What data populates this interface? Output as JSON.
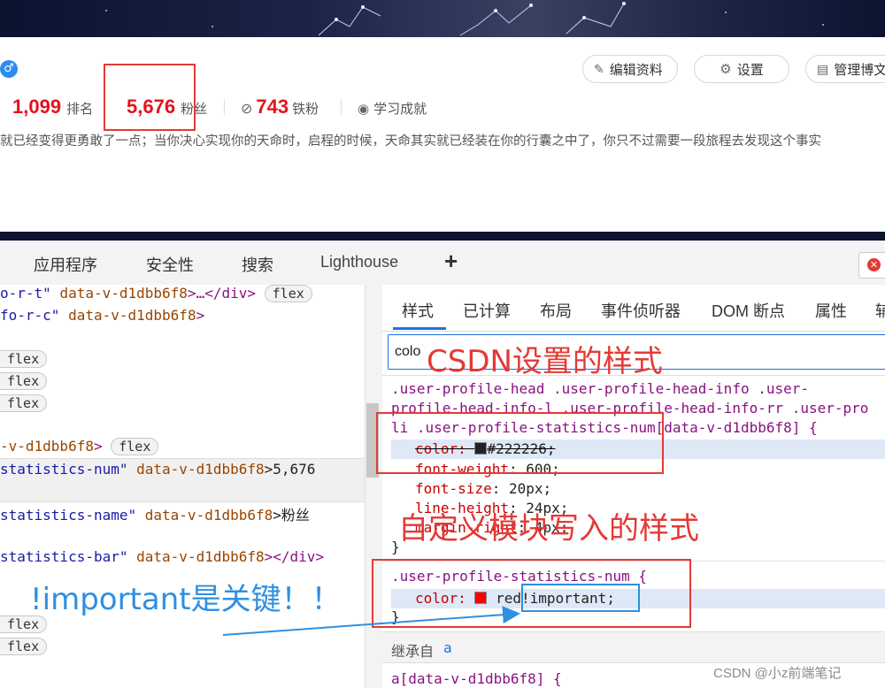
{
  "profile": {
    "buttons": {
      "edit": "编辑资料",
      "settings": "设置",
      "manage": "管理博文"
    },
    "stats": [
      {
        "num": "1,099",
        "name": "排名"
      },
      {
        "num": "5,676",
        "name": "粉丝"
      },
      {
        "num": "743",
        "name": "铁粉"
      }
    ],
    "achievement": "学习成就",
    "motto": "就已经变得更勇敢了一点；当你决心实现你的天命时，启程的时候，天命其实就已经装在你的行囊之中了，你只不过需要一段旅程去发现这个事实"
  },
  "devtools": {
    "tabs": [
      "应用程序",
      "安全性",
      "搜索",
      "Lighthouse"
    ],
    "add": "+",
    "subtabs": [
      "样式",
      "已计算",
      "布局",
      "事件侦听器",
      "DOM 断点",
      "属性",
      "辅"
    ],
    "filter_value": "colo",
    "elements": {
      "l1_attr": "o-r-t\"",
      "l1_dv": "data-v-d1dbb6f8",
      "l1_tail": ">…</div>",
      "flex": "flex",
      "l2_attr": "fo-r-c\"",
      "l2_dv": "data-v-d1dbb6f8",
      "l2_tail": ">",
      "l6_dv": "-v-d1dbb6f8",
      "l6_tail": ">",
      "l7_cls": "statistics-num\"",
      "l7_dv": "data-v-d1dbb6f8",
      "l7_tail": ">5,676",
      "l8_cls": "statistics-name\"",
      "l8_dv": "data-v-d1dbb6f8",
      "l8_tail": ">粉丝",
      "l9_cls": "statistics-bar\"",
      "l9_dv": "data-v-d1dbb6f8",
      "l9_tail": "></div>"
    },
    "rules": {
      "r1_sel_a": ".user-profile-head .user-profile-head-info .user-",
      "r1_sel_b": "profile-head-info-l .user-profile-head-info-rr .user-pro",
      "r1_sel_c": "li .user-profile-statistics-num[data-v-d1dbb6f8] {",
      "r1_color_prop": "color:",
      "r1_color_val": "#222226;",
      "r1_color_swatch": "#222226",
      "r1_fw": "font-weight",
      "r1_fw_val": "600;",
      "r1_fs": "font-size",
      "r1_fs_val": "20px;",
      "r1_lh": "line-height",
      "r1_lh_val": "24px;",
      "r1_mr": "margin-right",
      "r1_mr_val": "4px;",
      "close": "}",
      "r2_sel": ".user-profile-statistics-num {",
      "r2_prop": "color:",
      "r2_val": "red",
      "r2_swatch": "#ff0000",
      "r2_imp": "!important;",
      "inherited": "继承自",
      "inherited_a": "a",
      "r3_sel": "a[data-v-d1dbb6f8] {"
    }
  },
  "annotations": {
    "csdn": "CSDN设置的样式",
    "custom": "自定义模块写入的样式",
    "important": "!important是关键！！"
  },
  "watermark": "CSDN @小z前端笔记",
  "colors": {
    "annotation_red": "#e53935",
    "annotation_blue": "#2f8fe0",
    "stat_red": "#e6121d"
  }
}
